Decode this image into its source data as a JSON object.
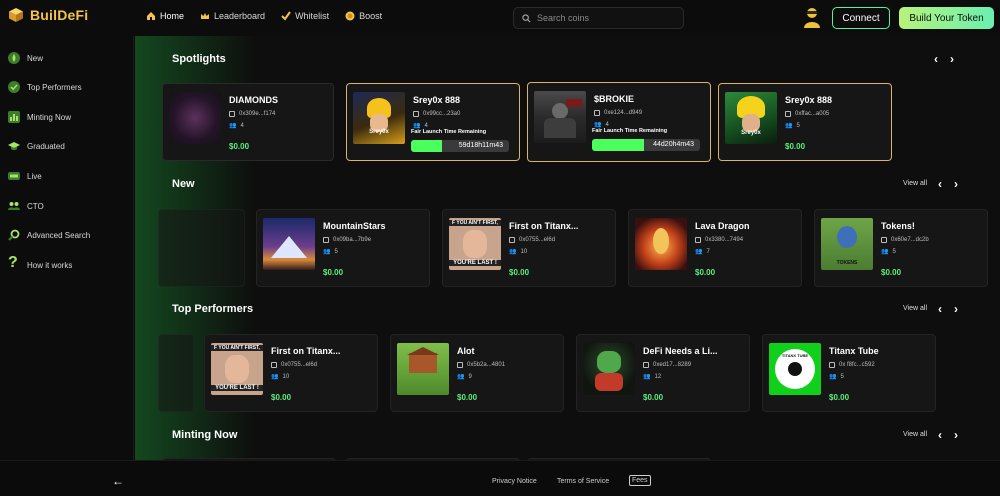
{
  "brand": {
    "name": "BuilDeFi",
    "accent": "#f3c34a"
  },
  "nav": [
    {
      "label": "Home",
      "icon": "home-icon"
    },
    {
      "label": "Leaderboard",
      "icon": "crown-icon"
    },
    {
      "label": "Whitelist",
      "icon": "check-icon"
    },
    {
      "label": "Boost",
      "icon": "coin-icon"
    }
  ],
  "search": {
    "placeholder": "Search coins"
  },
  "header": {
    "connect_label": "Connect",
    "build_label": "Build Your Token"
  },
  "sidebar": {
    "items": [
      {
        "label": "New",
        "icon": "flame-icon"
      },
      {
        "label": "Top Performers",
        "icon": "check-circle-icon"
      },
      {
        "label": "Minting Now",
        "icon": "bar-chart-icon"
      },
      {
        "label": "Graduated",
        "icon": "graduation-cap-icon"
      },
      {
        "label": "Live",
        "icon": "live-icon"
      },
      {
        "label": "CTO",
        "icon": "users-icon"
      },
      {
        "label": "Advanced Search",
        "icon": "magnifier-icon"
      },
      {
        "label": "How it works",
        "icon": "question-icon"
      }
    ]
  },
  "sections": {
    "spotlights": {
      "title": "Spotlights"
    },
    "new": {
      "title": "New",
      "view_all": "View all"
    },
    "top": {
      "title": "Top Performers",
      "view_all": "View all"
    },
    "minting": {
      "title": "Minting Now",
      "view_all": "View all"
    }
  },
  "spotlights": [
    {
      "name": "DIAMONDS",
      "addr": "0x309e...f174",
      "holders": "4",
      "price": "$0.00"
    },
    {
      "name": "Srey0x 888",
      "addr": "0x99cc...23a0",
      "holders": "4",
      "fair": "Fair Launch Time Remaining",
      "timer": "59d18h11m43",
      "progress": 0.32,
      "price": ""
    },
    {
      "name": "$BROKIE",
      "addr": "0xe124...d949",
      "holders": "4",
      "fair": "Fair Launch Time Remaining",
      "timer": "44d20h4m43",
      "progress": 0.48,
      "price": ""
    },
    {
      "name": "Srey0x 888",
      "addr": "0xffac...a005",
      "holders": "5",
      "price": "$0.00"
    }
  ],
  "new_tokens": [
    {
      "name": "MountainStars",
      "addr": "0x09ba...7b9e",
      "holders": "5",
      "price": "$0.00"
    },
    {
      "name": "First on Titanx...",
      "addr": "0x0755...el6d",
      "holders": "10",
      "price": "$0.00"
    },
    {
      "name": "Lava Dragon",
      "addr": "0x3380...7494",
      "holders": "7",
      "price": "$0.00"
    },
    {
      "name": "Tokens!",
      "addr": "0x60e7...dc2b",
      "holders": "5",
      "price": "$0.00"
    }
  ],
  "top_tokens": [
    {
      "name": "First on Titanx...",
      "addr": "0x0755...el6d",
      "holders": "10",
      "price": "$0.00"
    },
    {
      "name": "Alot",
      "addr": "0x5b2a...4801",
      "holders": "9",
      "price": "$0.00"
    },
    {
      "name": "DeFi Needs a Li...",
      "addr": "0xed17...8289",
      "holders": "12",
      "price": "$0.00"
    },
    {
      "name": "Titanx Tube",
      "addr": "0x f8fc...c592",
      "holders": "5",
      "price": "$0.00"
    }
  ],
  "thumb_text": {
    "meme_top": "F YOU AIN'T FIRST,",
    "meme_bottom": "YOU'RE LAST !",
    "tokens_label": "TOKENS",
    "tube_label": "TITANX TUBE",
    "srey_label": "Srey0x"
  },
  "footer": {
    "privacy": "Privacy Notice",
    "terms": "Terms of Service",
    "fees": "Fees"
  }
}
